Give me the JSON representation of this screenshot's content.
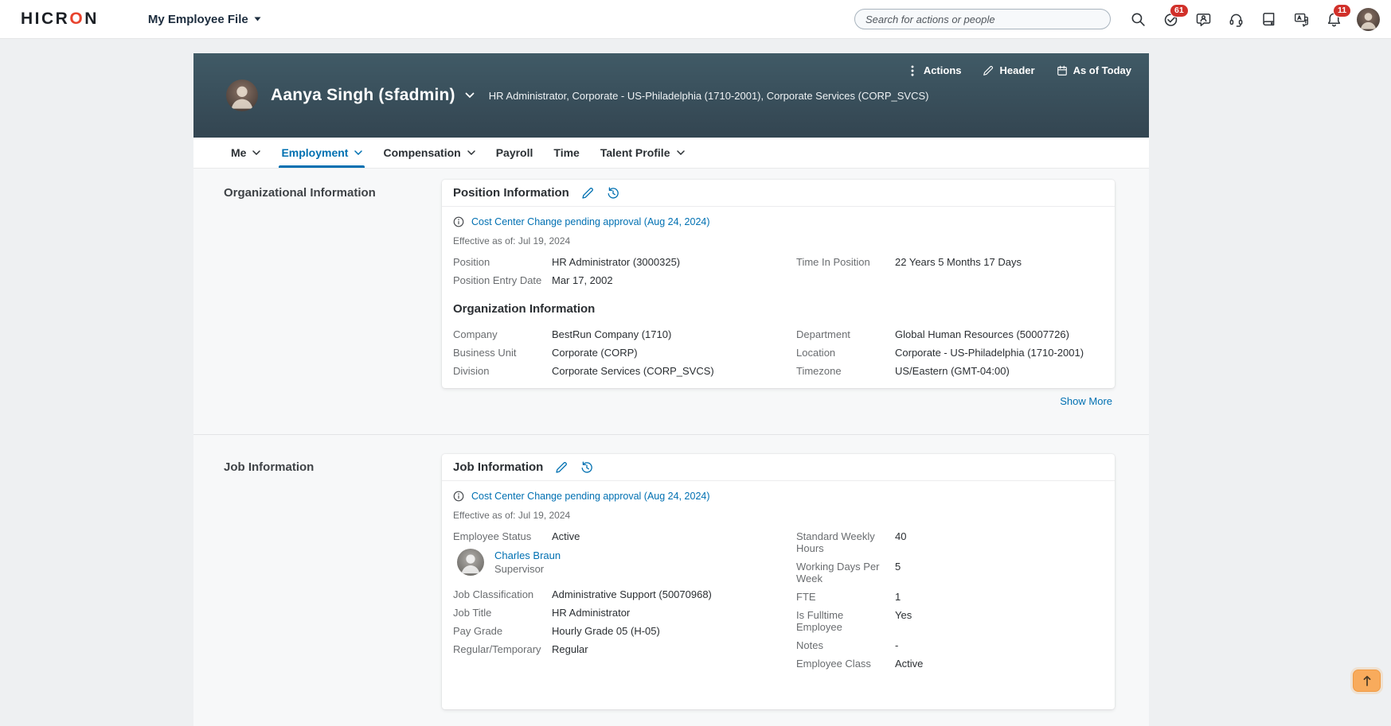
{
  "topbar": {
    "logo_pre": "HICR",
    "logo_o": "O",
    "logo_post": "N",
    "module_title": "My Employee File",
    "search_placeholder": "Search for actions or people",
    "todos_badge": "61",
    "notifications_badge": "11",
    "icons": [
      "search-icon",
      "todos-icon",
      "chat-icon",
      "support-icon",
      "directory-icon",
      "translation-icon",
      "notifications-icon",
      "profile-avatar"
    ]
  },
  "employee_header": {
    "name": "Aanya Singh (sfadmin)",
    "summary": "HR Administrator, Corporate - US-Philadelphia (1710-2001), Corporate Services (CORP_SVCS)",
    "actions_label": "Actions",
    "header_label": "Header",
    "as_of_label": "As of Today"
  },
  "tabs": [
    {
      "label": "Me",
      "dropdown": true,
      "active": false
    },
    {
      "label": "Employment",
      "dropdown": true,
      "active": true
    },
    {
      "label": "Compensation",
      "dropdown": true,
      "active": false
    },
    {
      "label": "Payroll",
      "dropdown": false,
      "active": false
    },
    {
      "label": "Time",
      "dropdown": false,
      "active": false
    },
    {
      "label": "Talent Profile",
      "dropdown": true,
      "active": false
    }
  ],
  "org_section": {
    "side_label": "Organizational Information",
    "card_title": "Position Information",
    "pending_note": "Cost Center Change pending approval (Aug 24, 2024)",
    "effective": "Effective as of: Jul 19, 2024",
    "position_fields_left": [
      {
        "label": "Position",
        "value": "HR Administrator (3000325)"
      },
      {
        "label": "Position Entry Date",
        "value": "Mar 17, 2002"
      }
    ],
    "position_fields_right": [
      {
        "label": "Time In Position",
        "value": "22 Years 5 Months 17 Days"
      }
    ],
    "subheader": "Organization Information",
    "org_fields_left": [
      {
        "label": "Company",
        "value": "BestRun Company (1710)"
      },
      {
        "label": "Business Unit",
        "value": "Corporate (CORP)"
      },
      {
        "label": "Division",
        "value": "Corporate Services (CORP_SVCS)"
      }
    ],
    "org_fields_right": [
      {
        "label": "Department",
        "value": "Global Human Resources (50007726)"
      },
      {
        "label": "Location",
        "value": "Corporate - US-Philadelphia (1710-2001)"
      },
      {
        "label": "Timezone",
        "value": "US/Eastern (GMT-04:00)"
      }
    ],
    "show_more": "Show More"
  },
  "job_section": {
    "side_label": "Job Information",
    "card_title": "Job Information",
    "pending_note": "Cost Center Change pending approval (Aug 24, 2024)",
    "effective": "Effective as of: Jul 19, 2024",
    "fields_left_top": [
      {
        "label": "Employee Status",
        "value": "Active"
      }
    ],
    "supervisor": {
      "name": "Charles Braun",
      "role": "Supervisor"
    },
    "fields_left": [
      {
        "label": "Job Classification",
        "value": "Administrative Support (50070968)"
      },
      {
        "label": "Job Title",
        "value": "HR Administrator"
      },
      {
        "label": "Pay Grade",
        "value": "Hourly Grade 05 (H-05)"
      },
      {
        "label": "Regular/Temporary",
        "value": "Regular"
      }
    ],
    "fields_right": [
      {
        "label": "Standard Weekly Hours",
        "value": "40"
      },
      {
        "label": "Working Days Per Week",
        "value": "5"
      },
      {
        "label": "FTE",
        "value": "1"
      },
      {
        "label": "Is Fulltime Employee",
        "value": "Yes"
      },
      {
        "label": "Notes",
        "value": "-"
      },
      {
        "label": "Employee Class",
        "value": "Active"
      }
    ]
  },
  "colors": {
    "accent_blue": "#0070b1",
    "logo_accent": "#e8432d",
    "badge_red": "#d1302a",
    "band_top": "#405a66",
    "band_bottom": "#334551",
    "scroll_button": "#f8ab5c"
  }
}
